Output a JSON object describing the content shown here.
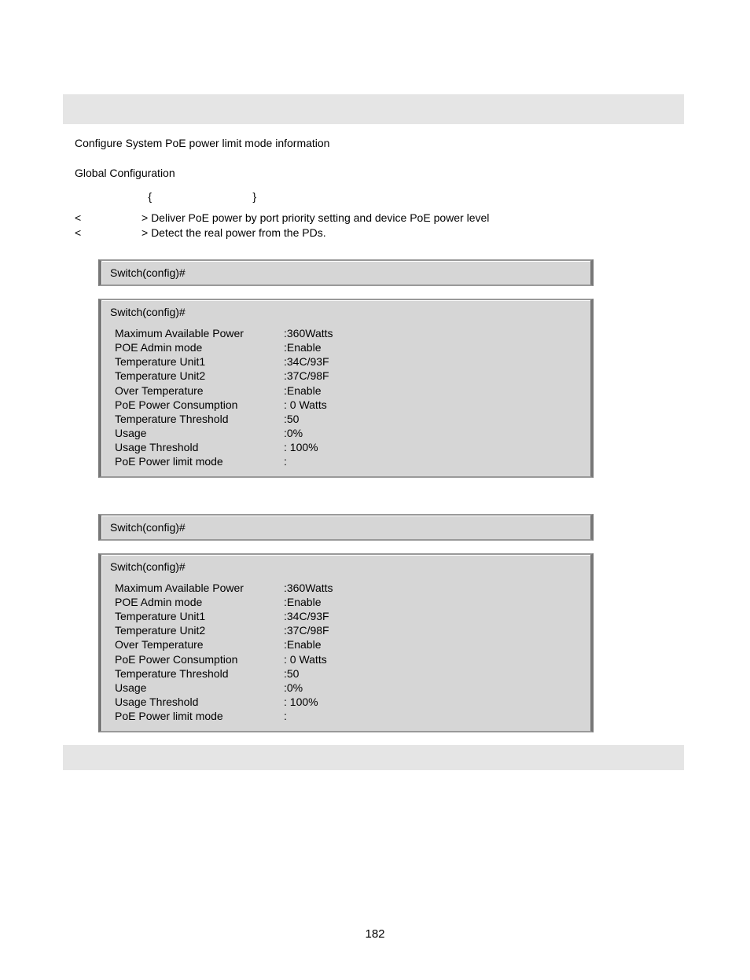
{
  "description": "Configure System PoE power limit mode information",
  "mode": "Global Configuration",
  "syntaxPrefix": "                        {",
  "syntaxSuffix": "                                 }",
  "params": [
    {
      "left": "<",
      "right": "> Deliver PoE power by port priority setting and device PoE power level"
    },
    {
      "left": "<",
      "right": "> Detect the real power from the PDs."
    }
  ],
  "example1Prompt": "Switch(config)#",
  "result1Prompt": "Switch(config)#",
  "example2Prompt": "Switch(config)#",
  "result2Prompt": "Switch(config)#",
  "kv": [
    {
      "key": "Maximum Available Power",
      "val": ":360Watts"
    },
    {
      "key": "POE Admin mode",
      "val": ":Enable"
    },
    {
      "key": "Temperature Unit1",
      "val": ":34C/93F"
    },
    {
      "key": "Temperature Unit2",
      "val": ":37C/98F"
    },
    {
      "key": "Over Temperature",
      "val": ":Enable"
    },
    {
      "key": "PoE Power Consumption",
      "val": ": 0 Watts"
    },
    {
      "key": "Temperature Threshold",
      "val": ":50"
    },
    {
      "key": "Usage",
      "val": ":0%"
    },
    {
      "key": "Usage Threshold",
      "val": ": 100%"
    },
    {
      "key": "PoE Power limit mode",
      "val": ":"
    }
  ],
  "pageNumber": "182"
}
